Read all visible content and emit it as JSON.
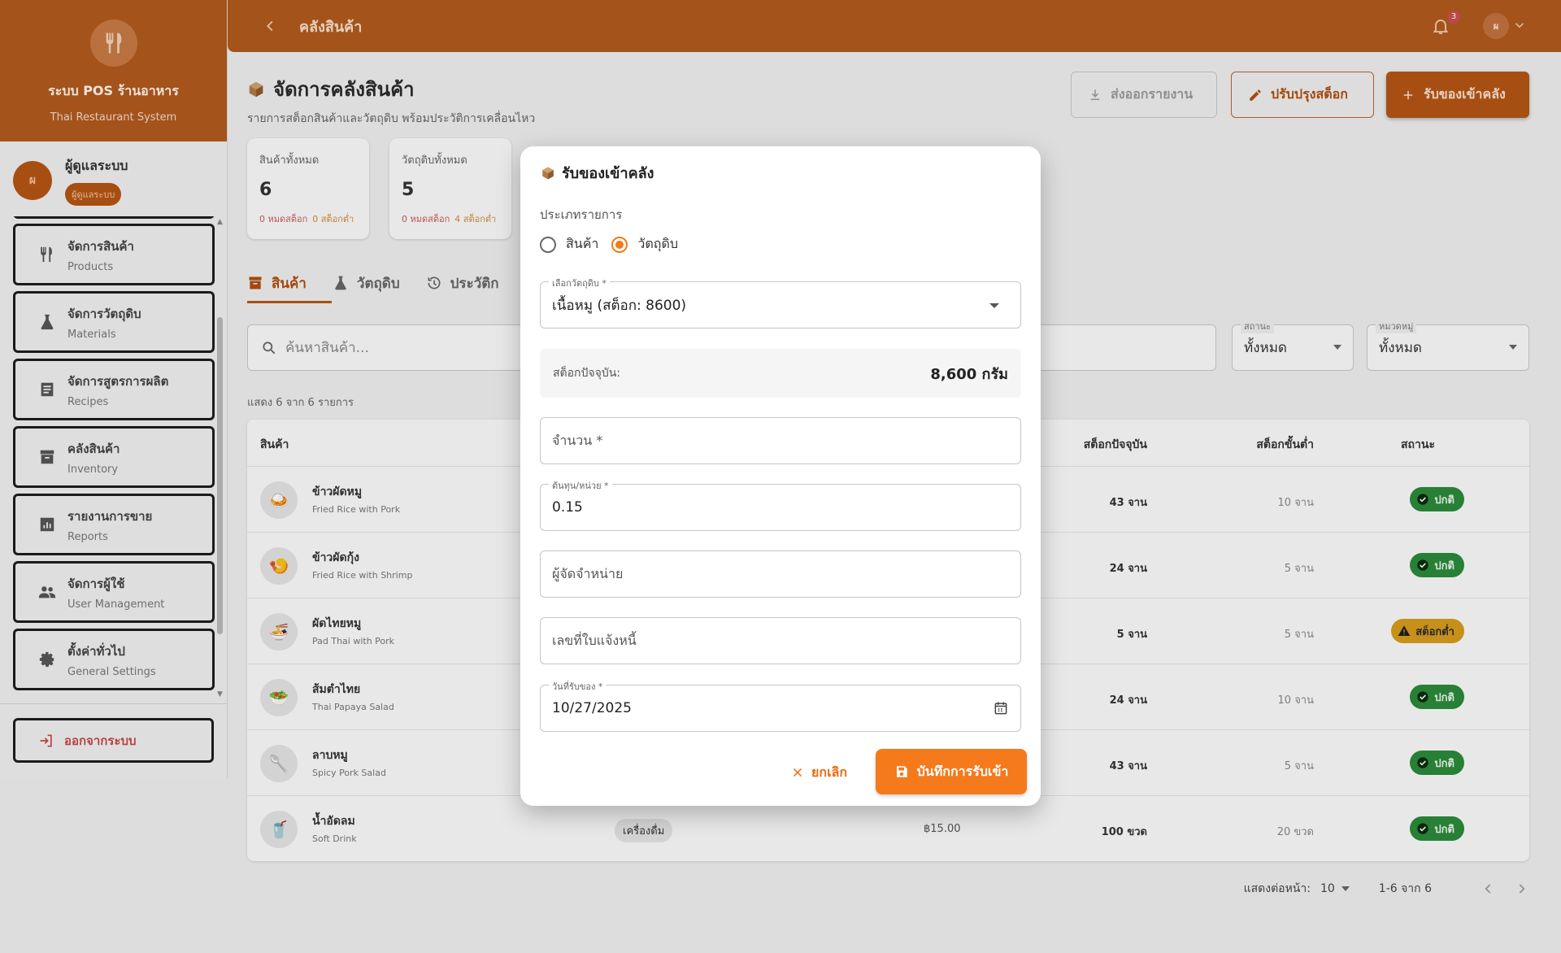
{
  "sidebar": {
    "brand_title": "ระบบ POS ร้านอาหาร",
    "brand_sub": "Thai Restaurant System",
    "user": {
      "initial": "ผ",
      "name": "ผู้ดูแลระบบ",
      "role": "ผู้ดูแลระบบ"
    },
    "items": [
      {
        "label": "จัดการสินค้า",
        "sub": "Products",
        "icon": "utensils-icon"
      },
      {
        "label": "จัดการวัตถุดิบ",
        "sub": "Materials",
        "icon": "flask-icon"
      },
      {
        "label": "จัดการสูตรการผลิต",
        "sub": "Recipes",
        "icon": "document-icon"
      },
      {
        "label": "คลังสินค้า",
        "sub": "Inventory",
        "icon": "archive-icon"
      },
      {
        "label": "รายงานการขาย",
        "sub": "Reports",
        "icon": "chart-icon"
      },
      {
        "label": "จัดการผู้ใช้",
        "sub": "User Management",
        "icon": "people-icon"
      },
      {
        "label": "ตั้งค่าทั่วไป",
        "sub": "General Settings",
        "icon": "gear-icon"
      }
    ],
    "logout": "ออกจากระบบ"
  },
  "topbar": {
    "title": "คลังสินค้า",
    "notif_count": "3",
    "avatar_initial": "ผ"
  },
  "page": {
    "title": "จัดการคลังสินค้า",
    "subtitle": "รายการสต็อกสินค้าและวัตถุดิบ พร้อมประวัติการเคลื่อนไหว",
    "btn_export": "ส่งออกรายงาน",
    "btn_adjust": "ปรับปรุงสต็อก",
    "btn_receive": "รับของเข้าคลัง"
  },
  "stats": [
    {
      "label": "สินค้าทั้งหมด",
      "value": "6",
      "out": "0 หมดสต็อก",
      "low": "0 สต็อกต่ำ"
    },
    {
      "label": "วัตถุดิบทั้งหมด",
      "value": "5",
      "out": "0 หมดสต็อก",
      "low": "4 สต็อกต่ำ"
    }
  ],
  "tabs": [
    "สินค้า",
    "วัตถุดิบ",
    "ประวัติก"
  ],
  "search": {
    "placeholder": "ค้นหาสินค้า..."
  },
  "filters": {
    "status": {
      "label": "สถานะ",
      "value": "ทั้งหมด"
    },
    "category": {
      "label": "หมวดหมู่",
      "value": "ทั้งหมด"
    }
  },
  "count_text": "แสดง 6 จาก 6 รายการ",
  "table": {
    "headers": {
      "product": "สินค้า",
      "stock": "สต็อกปัจจุบัน",
      "min": "สต็อกขั้นต่ำ",
      "status": "สถานะ"
    },
    "rows": [
      {
        "emoji": "🍛",
        "name": "ข้าวผัดหมู",
        "en": "Fried Rice with Pork",
        "cat": "",
        "price": "",
        "stock": "43 จาน",
        "min": "10 จาน",
        "status": "ปกติ",
        "state": "ok"
      },
      {
        "emoji": "🍤",
        "name": "ข้าวผัดกุ้ง",
        "en": "Fried Rice with Shrimp",
        "cat": "",
        "price": "",
        "stock": "24 จาน",
        "min": "5 จาน",
        "status": "ปกติ",
        "state": "ok"
      },
      {
        "emoji": "🍜",
        "name": "ผัดไทยหมู",
        "en": "Pad Thai with Pork",
        "cat": "",
        "price": "",
        "stock": "5 จาน",
        "min": "5 จาน",
        "status": "สต็อกต่ำ",
        "state": "low"
      },
      {
        "emoji": "🥗",
        "name": "ส้มตำไทย",
        "en": "Thai Papaya Salad",
        "cat": "",
        "price": "",
        "stock": "24 จาน",
        "min": "10 จาน",
        "status": "ปกติ",
        "state": "ok"
      },
      {
        "emoji": "🥄",
        "name": "ลาบหมู",
        "en": "Spicy Pork Salad",
        "cat": "",
        "price": "",
        "stock": "43 จาน",
        "min": "5 จาน",
        "status": "ปกติ",
        "state": "ok"
      },
      {
        "emoji": "🥤",
        "name": "น้ำอัดลม",
        "en": "Soft Drink",
        "cat": "เครื่องดื่ม",
        "price": "฿15.00",
        "stock": "100 ขวด",
        "min": "20 ขวด",
        "status": "ปกติ",
        "state": "ok"
      }
    ]
  },
  "pager": {
    "per_page_label": "แสดงต่อหน้า:",
    "per_page": "10",
    "range": "1-6 จาก 6"
  },
  "dialog": {
    "title": "รับของเข้าคลัง",
    "type_label": "ประเภทรายการ",
    "type_options": [
      "สินค้า",
      "วัตถุดิบ"
    ],
    "type_selected": "วัตถุดิบ",
    "material_label": "เลือกวัตถุดิบ *",
    "material_value": "เนื้อหมู (สต็อก: 8600)",
    "current_stock_label": "สต็อกปัจจุบัน:",
    "current_stock_value": "8,600 กรัม",
    "qty_placeholder": "จำนวน *",
    "cost_label": "ต้นทุน/หน่วย *",
    "cost_value": "0.15",
    "supplier_placeholder": "ผู้จัดจำหน่าย",
    "invoice_placeholder": "เลขที่ใบแจ้งหนี้",
    "date_label": "วันที่รับของ *",
    "date_value": "10/27/2025",
    "cancel": "ยกเลิก",
    "save": "บันทึกการรับเข้า"
  },
  "colors": {
    "brand": "#b15a1e",
    "accent": "#f47a1c",
    "ok": "#2a8a3a",
    "low": "#d79b1c"
  }
}
